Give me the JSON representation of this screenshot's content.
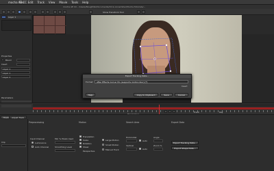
{
  "menubar": {
    "app": "mocha AE CC",
    "menus": [
      "File",
      "Edit",
      "Track",
      "View",
      "Movie",
      "Tools",
      "Help"
    ]
  },
  "window": {
    "title": "mocha AE CC - /Users/NoughtKo/Documents/Chris Annemiller/Mocha Tutorials/..."
  },
  "toolbar": {
    "transform_label": "Show Transform Tool"
  },
  "left_panel": {
    "section_properties": "Properties",
    "section_params": "Parameters",
    "rows": [
      "Layer 1",
      "Blend",
      "Insert",
      "Layer 1",
      "Layer 1",
      "Layer 2"
    ]
  },
  "dialog": {
    "title": "Export Tracking Data...",
    "format_label": "Format",
    "format_value": "After Effects Corner Pin (supports motion blur) [*]",
    "insert": "Insert",
    "help": "Help",
    "copy": "Copy to Clipboard",
    "save": "Save",
    "cancel": "Cancel"
  },
  "timeline": {
    "track_label": "Track",
    "key_label": "Key",
    "parameters_label": "Parameters"
  },
  "params": {
    "tabs": [
      "Track",
      "Adjust Track"
    ],
    "headers": {
      "preprocessing": "Preprocessing",
      "motion": "Motion",
      "search_area": "Search Area",
      "export_data": "Export Data"
    },
    "clip_label": "Clip",
    "input_channel": "Input Channel",
    "luminance": "Luminance",
    "auto_channel": "Auto Channel",
    "min_pixels": "Min % Pixels Used",
    "smoothing": "Smoothing Level",
    "translation": "Translation",
    "scale": "Scale",
    "rotation": "Rotation",
    "shear": "Shear",
    "perspective": "Perspective",
    "large_motion": "Large Motion",
    "small_motion": "Small Motion",
    "manual_track": "Manual Track",
    "horizontal": "Horizontal",
    "vertical": "Vertical",
    "auto": "Auto",
    "angle": "Angle",
    "zoom": "Zoom %",
    "export_tracking": "Export Tracking Data...",
    "export_shape": "Export Shape Data..."
  }
}
